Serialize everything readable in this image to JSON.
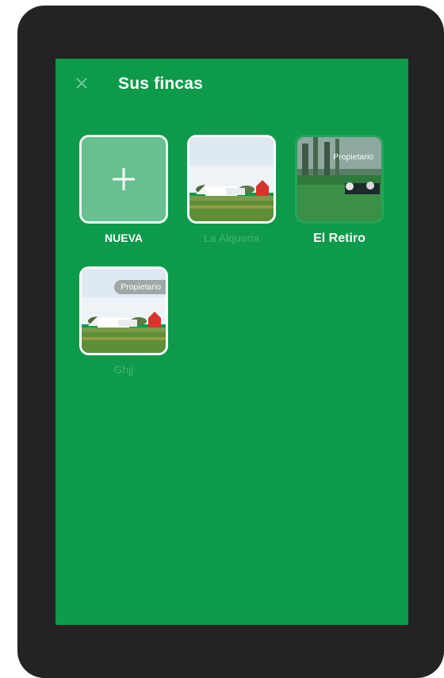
{
  "header": {
    "title": "Sus fincas",
    "close_icon": "close-icon"
  },
  "farms": [
    {
      "label": "NUEVA",
      "type": "new",
      "icon": "plus-icon"
    },
    {
      "label": "La Alqueria",
      "type": "farm",
      "badge": ""
    },
    {
      "label": "El Retiro",
      "type": "farm",
      "badge": "Propietario"
    },
    {
      "label": "Ghjj",
      "type": "farm",
      "badge": "Propietario"
    }
  ],
  "colors": {
    "screen_bg": "#0d9a4b",
    "frame": "#252223",
    "new_tile": "#68bf8f",
    "dim_text": "#43b574"
  }
}
